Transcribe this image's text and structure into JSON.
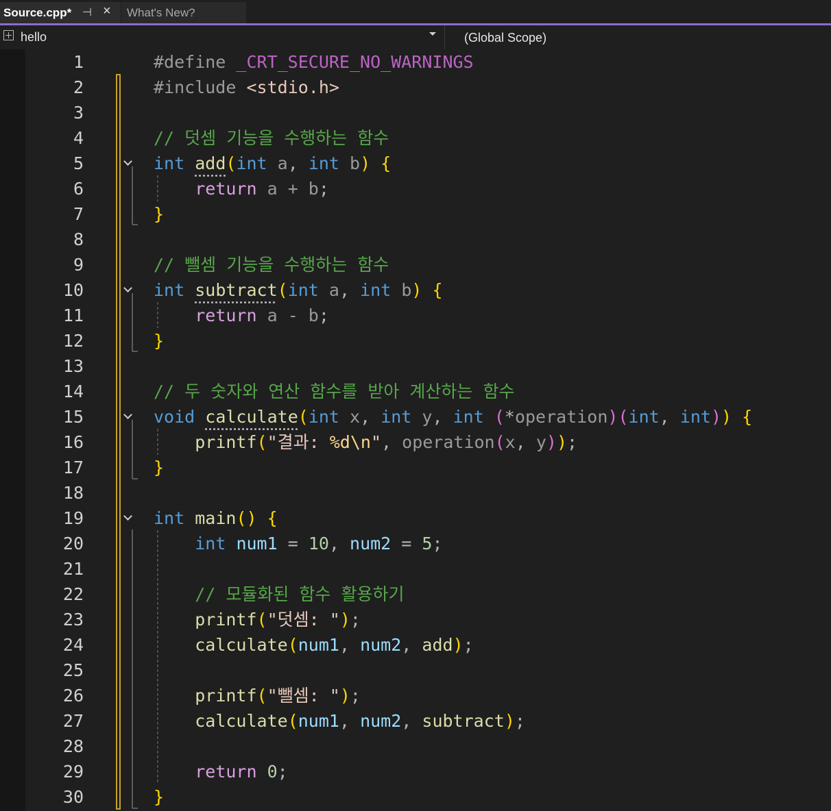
{
  "tabs": [
    {
      "title": "Source.cpp*",
      "active": true,
      "pin_icon": "pin-icon",
      "close_icon": "close-icon"
    },
    {
      "title": "What's New?",
      "active": false
    }
  ],
  "navbar": {
    "project": "hello",
    "project_icon": "cpp-project-icon",
    "scope": "(Global Scope)"
  },
  "colors": {
    "accent": "#8c6cd0",
    "keyword": "#569cd6",
    "control_keyword": "#d8a0df",
    "function": "#dcdcaa",
    "comment": "#57a64a",
    "number": "#b5cea8",
    "string": "#e8c9bb",
    "brace": "#ffd700",
    "change_margin": "#c9a227"
  },
  "editor": {
    "line_numbers": [
      "1",
      "2",
      "3",
      "4",
      "5",
      "6",
      "7",
      "8",
      "9",
      "10",
      "11",
      "12",
      "13",
      "14",
      "15",
      "16",
      "17",
      "18",
      "19",
      "20",
      "21",
      "22",
      "23",
      "24",
      "25",
      "26",
      "27",
      "28",
      "29",
      "30"
    ],
    "code": {
      "l1": {
        "pp": "#define",
        "macro": "_CRT_SECURE_NO_WARNINGS"
      },
      "l2": {
        "pp": "#include",
        "header": "<stdio.h>"
      },
      "l4": {
        "comment": "// 덧셈 기능을 수행하는 함수"
      },
      "l5": {
        "kw1": "int",
        "fn": "add",
        "kw2": "int",
        "p1": "a",
        "kw3": "int",
        "p2": "b"
      },
      "l6": {
        "ret": "return",
        "expr": "a + b"
      },
      "l9": {
        "comment": "// 뺄셈 기능을 수행하는 함수"
      },
      "l10": {
        "kw1": "int",
        "fn": "subtract",
        "kw2": "int",
        "p1": "a",
        "kw3": "int",
        "p2": "b"
      },
      "l11": {
        "ret": "return",
        "expr": "a - b"
      },
      "l14": {
        "comment": "// 두 숫자와 연산 함수를 받아 계산하는 함수"
      },
      "l15": {
        "kw1": "void",
        "fn": "calculate",
        "kw2": "int",
        "p1": "x",
        "kw3": "int",
        "p2": "y",
        "kw4": "int",
        "p3": "operation",
        "kw5": "int",
        "kw6": "int"
      },
      "l16": {
        "fn": "printf",
        "str1": "\"결과: ",
        "fmt": "%d\\n",
        "str2": "\"",
        "call": "operation",
        "a1": "x",
        "a2": "y"
      },
      "l19": {
        "kw1": "int",
        "fn": "main"
      },
      "l20": {
        "kw1": "int",
        "v1": "num1",
        "n1": "10",
        "v2": "num2",
        "n2": "5"
      },
      "l22": {
        "comment": "// 모듈화된 함수 활용하기"
      },
      "l23": {
        "fn": "printf",
        "str": "\"덧셈: \""
      },
      "l24": {
        "fn": "calculate",
        "a1": "num1",
        "a2": "num2",
        "a3": "add"
      },
      "l26": {
        "fn": "printf",
        "str": "\"뺄셈: \""
      },
      "l27": {
        "fn": "calculate",
        "a1": "num1",
        "a2": "num2",
        "a3": "subtract"
      },
      "l29": {
        "ret": "return",
        "n": "0"
      }
    }
  }
}
